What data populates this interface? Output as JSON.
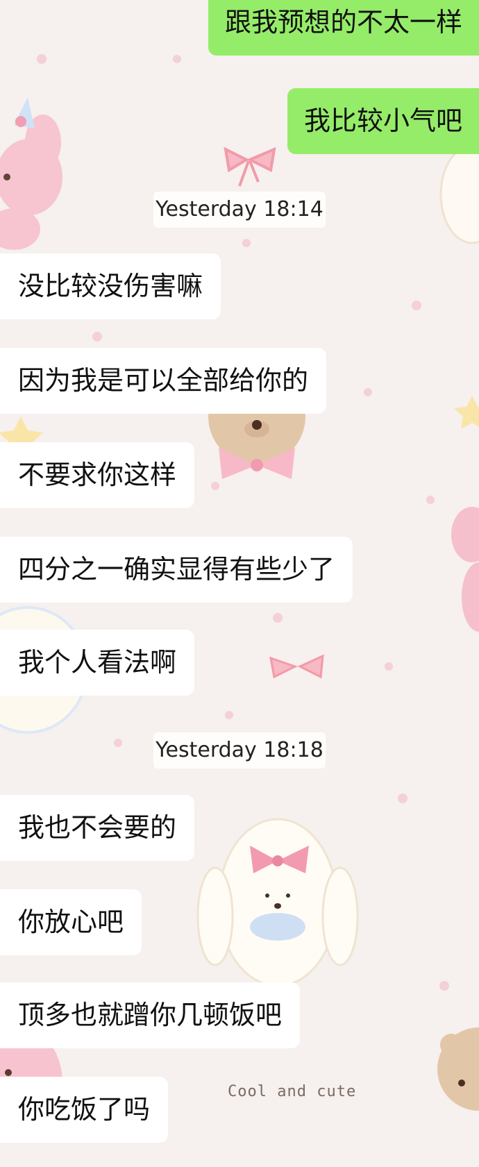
{
  "messages": {
    "out_1": "跟我预想的不太一样",
    "out_2": "我比较小气吧",
    "time_1": "Yesterday 18:14",
    "in_1": "没比较没伤害嘛",
    "in_2": "因为我是可以全部给你的",
    "in_3": "不要求你这样",
    "in_4": "四分之一确实显得有些少了",
    "in_5": "我个人看法啊",
    "time_2": "Yesterday 18:18",
    "in_6": "我也不会要的",
    "in_7": "你放心吧",
    "in_8": "顶多也就蹭你几顿饭吧",
    "in_9": "你吃饭了吗"
  },
  "wallpaper": {
    "caption": "Cool and cute"
  },
  "colors": {
    "outgoing_bubble": "#95ec69",
    "incoming_bubble": "#ffffff",
    "background": "#f6f0ee"
  }
}
